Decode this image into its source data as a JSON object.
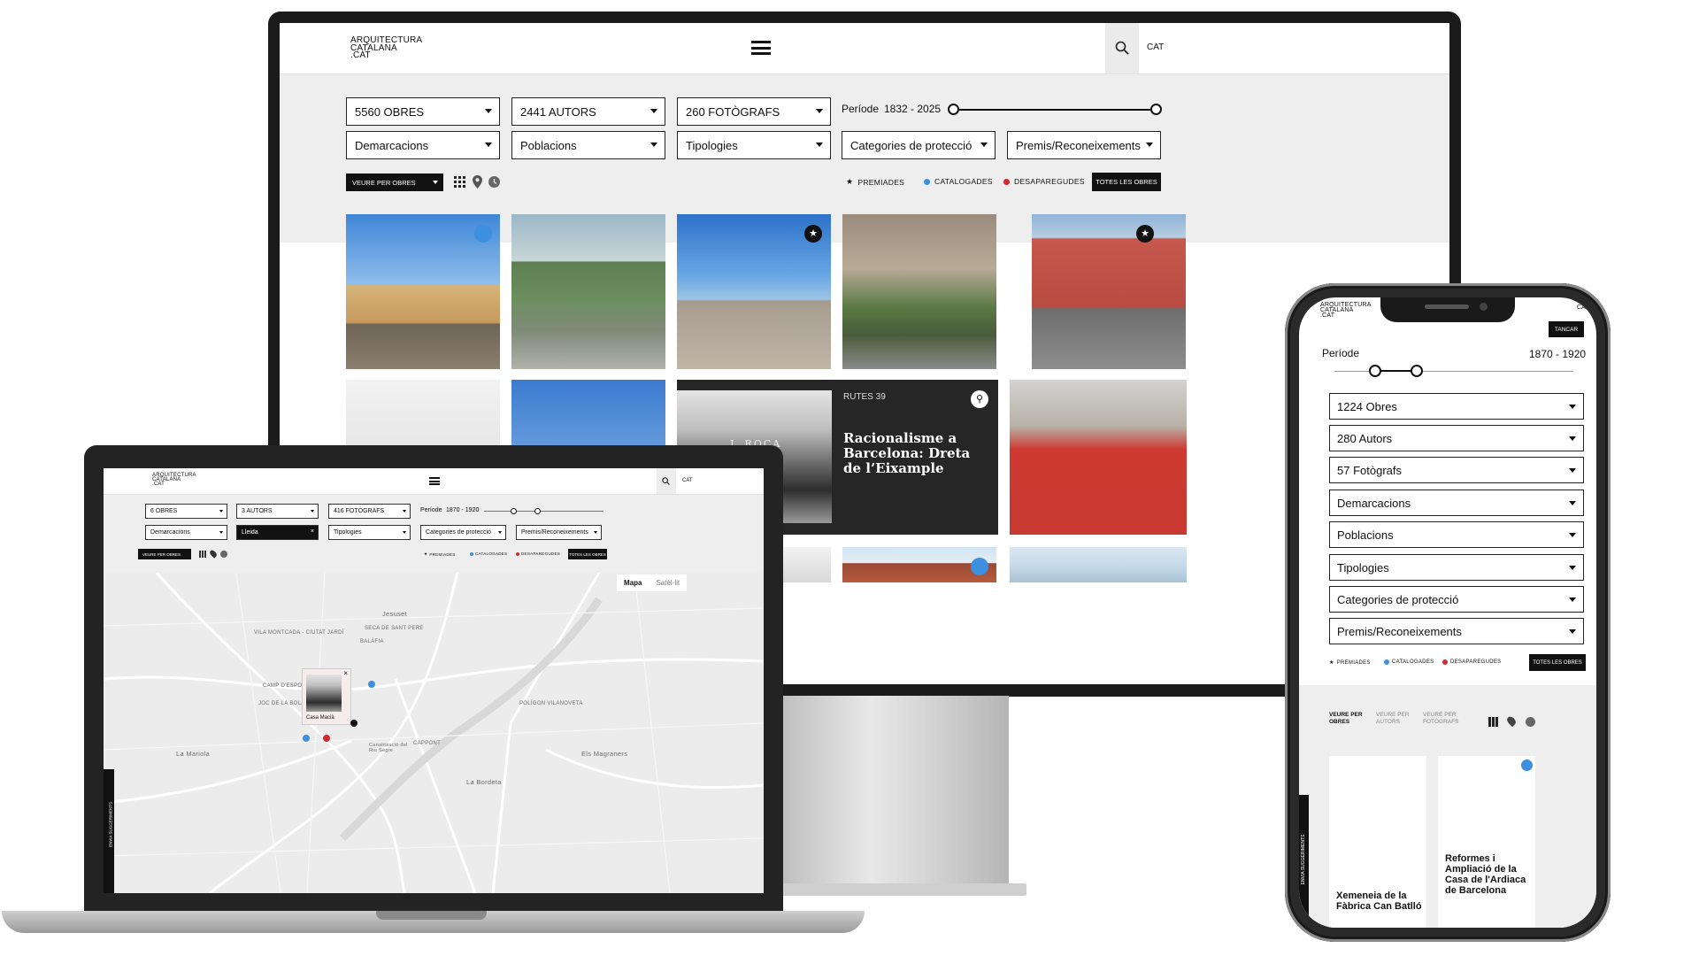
{
  "monitor": {
    "logo": [
      "ARQUITECTURA",
      "CATALANA",
      ".CAT"
    ],
    "lang": "CAT",
    "filters_row1": [
      "5560 OBRES",
      "2441 AUTORS",
      "260 FOTÒGRAFS"
    ],
    "period_label": "Període",
    "period_range": "1832 - 2025",
    "filters_row2": [
      "Demarcacions",
      "Poblacions",
      "Tipologies",
      "Categories de protecció",
      "Premis/Reconeixements"
    ],
    "view_select": "VEURE PER OBRES",
    "legend": [
      "PREMIADES",
      "CATALOGADES",
      "DESAPAREGUDES"
    ],
    "all_button": "TOTES LES OBRES",
    "feature": {
      "tag": "RUTES 39",
      "title": "Racionalisme a Barcelona: Dreta de l’Eixample",
      "sign": "J. ROCA"
    }
  },
  "laptop": {
    "logo": [
      "ARQUITECTURA",
      "CATALANA",
      ".CAT"
    ],
    "lang": "CAT",
    "filters_row1": [
      "6 OBRES",
      "3 AUTORS",
      "416 FOTÒGRAFS"
    ],
    "period_label": "Període",
    "period_range": "1870 - 1920",
    "filters_row2": [
      "Demarcacions",
      "Lleida",
      "Tipologies",
      "Categories de protecció",
      "Premis/Reconeixements"
    ],
    "view_select": "VEURE PER OBRES",
    "legend": [
      "PREMIADES",
      "CATALOGADES",
      "DESAPAREGUDES"
    ],
    "all_button": "TOTES LES OBRES",
    "map_tabs": [
      "Mapa",
      "Satèl·lit"
    ],
    "map_labels": [
      "Jesuset",
      "VILA MONTCADA - CIUTAT JARDÍ",
      "SECA DE SANT PERE",
      "BALÀFIA",
      "CAMP D'ESPORTS-FLE",
      "JOC DE LA BOLA",
      "POLÍGON VILANOVETA",
      "CAPPONT",
      "La Mariola",
      "Els Magraners",
      "La Bordeta",
      "Canalització del Riu Segre"
    ],
    "popup_label": "Casa Macià",
    "side_tab": "ENVIA SUGGERIMENTS"
  },
  "phone": {
    "logo": [
      "ARQUITECTURA",
      "CATALANA",
      ".CAT"
    ],
    "lang": "CA",
    "close": "TANCAR",
    "period_label": "Període",
    "period_range": "1870 - 1920",
    "selects": [
      "1224 Obres",
      "280 Autors",
      "57 Fotògrafs",
      "Demarcacions",
      "Poblacions",
      "Tipologies",
      "Categories de protecció",
      "Premis/Reconeixements"
    ],
    "legend": [
      "PREMIADES",
      "CATALOGADES",
      "DESAPAREGUDES"
    ],
    "all_button": "TOTES LES OBRES",
    "view_tabs": [
      "VEURE PER OBRES",
      "VEURE PER AUTORS",
      "VEURE PER FOTÒGRAFS"
    ],
    "cards": [
      "Xemeneia de la Fàbrica Can Batlló",
      "Reformes i Ampliació de la Casa de l'Ardiaca de Barcelona"
    ],
    "side_tab": "ENVIA SUGGERIMENTS"
  },
  "colors": {
    "premiades": "#111111",
    "catalogades": "#3d8fe0",
    "desaparegudes": "#d12a2a"
  },
  "icons": [
    "hamburger-icon",
    "search-icon",
    "grid-icon",
    "map-pin-icon",
    "clock-icon",
    "star-icon",
    "bike-icon",
    "close-icon"
  ]
}
